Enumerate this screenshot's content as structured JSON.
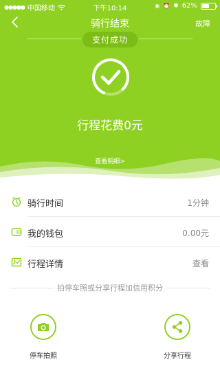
{
  "status_bar": {
    "carrier": "中国移动",
    "time": "下午10:14",
    "battery": "62%",
    "battery_level": 0.62
  },
  "header": {
    "title": "骑行结束",
    "right_action": "故障",
    "badge": "支付成功"
  },
  "summary": {
    "cost_text": "行程花费0元",
    "detail_link": "查看明细>"
  },
  "rows": [
    {
      "label": "骑行时间",
      "value": "1分钟",
      "icon": "clock-icon"
    },
    {
      "label": "我的钱包",
      "value": "0.00元",
      "icon": "wallet-icon"
    },
    {
      "label": "行程详情",
      "value": "查看",
      "icon": "map-icon"
    }
  ],
  "hint": "拍停车照或分享行程加信用积分",
  "actions": [
    {
      "label": "停车拍照",
      "icon": "camera-icon"
    },
    {
      "label": "分享行程",
      "icon": "share-icon"
    }
  ],
  "colors": {
    "brand_green": "#8fd123",
    "badge_green": "#7bbd14"
  }
}
